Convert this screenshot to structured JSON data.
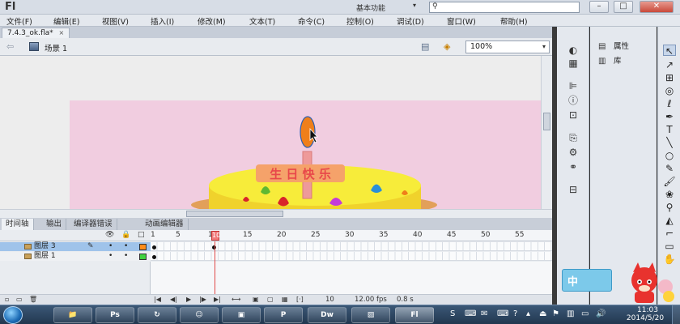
{
  "titlebar": {
    "app_logo": "Fl",
    "workspace": "基本功能",
    "search_placeholder": "",
    "close_label": "✕",
    "minimize_label": "–",
    "maximize_label": "□"
  },
  "menu": {
    "items": [
      "文件(F)",
      "编辑(E)",
      "视图(V)",
      "插入(I)",
      "修改(M)",
      "文本(T)",
      "命令(C)",
      "控制(O)",
      "调试(D)",
      "窗口(W)",
      "帮助(H)"
    ]
  },
  "document": {
    "tab_title": "7.4.3_ok.fla*",
    "tab_close": "×"
  },
  "editbar": {
    "scene_label": "场景 1",
    "zoom_value": "100%"
  },
  "stage": {
    "banner_text": "生 日 快 乐",
    "background_color": "#f1cde0",
    "cake_color": "#f7ec3a",
    "flame_color": "#ef7f1a"
  },
  "timeline_tabs": [
    "时间轴",
    "输出",
    "编译器错误",
    "动画编辑器"
  ],
  "timeline": {
    "ruler": [
      "1",
      "5",
      "10",
      "15",
      "20",
      "25",
      "30",
      "35",
      "40",
      "45",
      "50",
      "55"
    ],
    "playhead": "10",
    "layers": [
      {
        "name": "图层 3",
        "color": "#ff8c1a",
        "selected": true
      },
      {
        "name": "图层 1",
        "color": "#3fd23f",
        "selected": false
      }
    ],
    "footer": {
      "current_frame": "10",
      "fps": "12.00 fps",
      "time": "0.8 s"
    }
  },
  "properties_panel": {
    "properties_label": "属性",
    "library_label": "库"
  },
  "ime": {
    "mode": "中"
  },
  "taskbar": {
    "apps": [
      {
        "name": "file-explorer",
        "label": "📁"
      },
      {
        "name": "photoshop",
        "label": "Ps"
      },
      {
        "name": "refresh-app",
        "label": "↻"
      },
      {
        "name": "qq",
        "label": "☺"
      },
      {
        "name": "camera-app",
        "label": "▣"
      },
      {
        "name": "powerpoint",
        "label": "P"
      },
      {
        "name": "dreamweaver",
        "label": "Dw"
      },
      {
        "name": "image-viewer",
        "label": "▨"
      },
      {
        "name": "flash",
        "label": "Fl"
      }
    ],
    "clock_time": "11:03",
    "clock_date": "2014/5/20"
  }
}
